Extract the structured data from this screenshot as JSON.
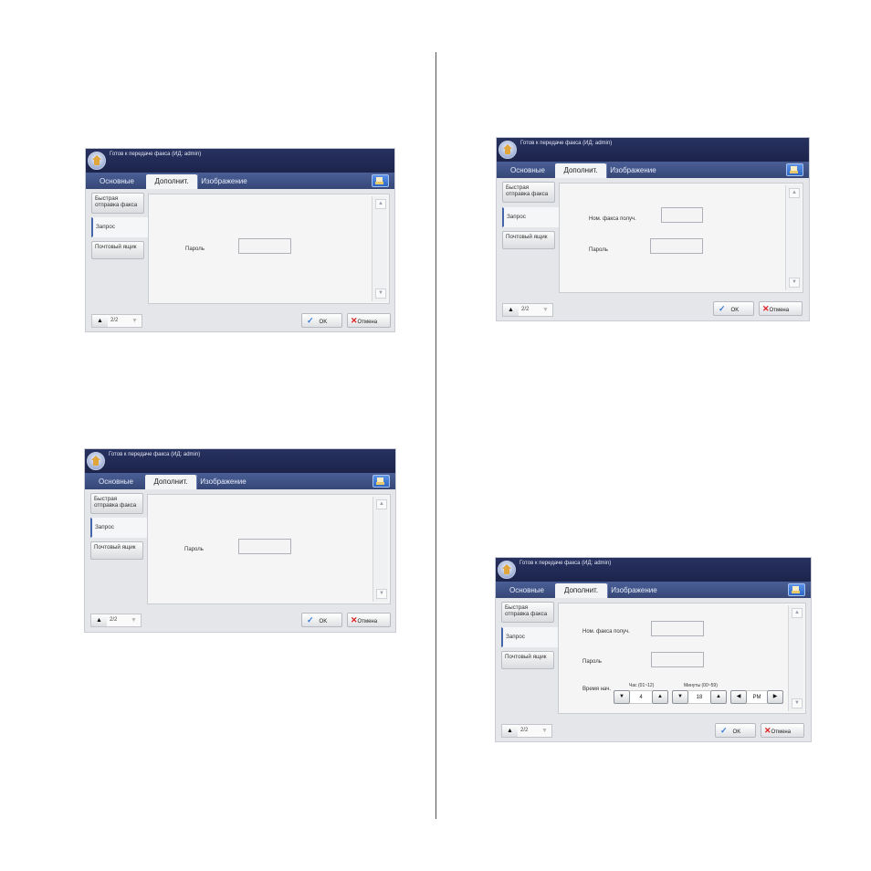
{
  "status_text": "Готов к передаче факса (ИД: admin)",
  "tabs": [
    "Основные",
    "Дополнит.",
    "Изображение"
  ],
  "side_items": [
    "Быстрая отправка факса",
    "Запрос",
    "Почтовый ящик"
  ],
  "fields": {
    "fax_number": "Ном. факса получ.",
    "password": "Пароль",
    "start_time": "Время нач."
  },
  "time": {
    "hour_label": "Час (01~12)",
    "minute_label": "Минуты (00~59)",
    "hour": "4",
    "minute": "18",
    "ampm": "PM"
  },
  "pager": "2/2",
  "ok_label": "OK",
  "cancel_label": "Отмена",
  "icons": [
    "home-icon",
    "tray-icon",
    "check-icon",
    "x-icon",
    "up-arrow-icon",
    "down-arrow-icon",
    "left-arrow-icon",
    "right-arrow-icon"
  ]
}
